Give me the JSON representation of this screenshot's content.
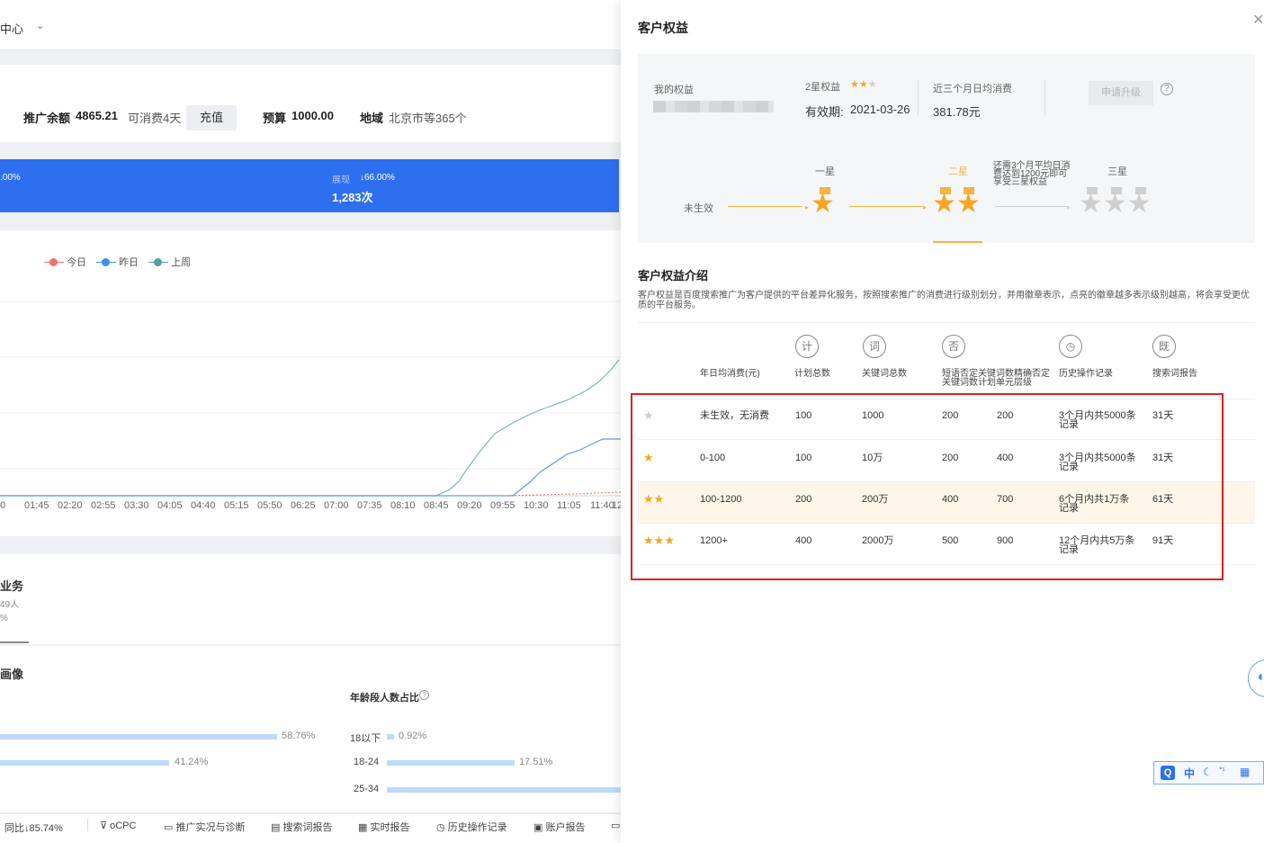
{
  "left": {
    "nav_title": "中心",
    "nav_chevron": "chevron-down-icon",
    "account": {
      "balance_label": "推广余额",
      "balance_value": "4865.21",
      "days_text": "可消费4天",
      "recharge_label": "充值",
      "budget_label": "预算",
      "budget_value": "1000.00",
      "region_label": "地域",
      "region_value": "北京市等365个"
    },
    "metric_bar": {
      "left_value": ".00%",
      "right_label": "展现",
      "right_change": "↓66.00%",
      "right_value": "1,283次"
    },
    "legend": [
      {
        "label": "今日",
        "color": "#f07070"
      },
      {
        "label": "昨日",
        "color": "#3f8ef0"
      },
      {
        "label": "上周",
        "color": "#4fa3a0"
      }
    ],
    "x_ticks": [
      "0",
      "01:45",
      "02:20",
      "02:55",
      "03:30",
      "04:05",
      "04:40",
      "05:15",
      "05:50",
      "06:25",
      "07:00",
      "07:35",
      "08:10",
      "08:45",
      "09:20",
      "09:55",
      "10:30",
      "11:05",
      "11:40",
      "12"
    ],
    "business": {
      "title": "业务",
      "sub1": "49人",
      "sub2": "%"
    },
    "portrait": {
      "title": "画像",
      "age_title": "年龄段人数占比",
      "gender_bars": [
        "58.76%",
        "41.24%"
      ],
      "age_rows": [
        {
          "label": "18以下",
          "value": "0.92%"
        },
        {
          "label": "18-24",
          "value": "17.51%"
        },
        {
          "label": "25-34",
          "value": ""
        }
      ]
    },
    "bottom_bar": {
      "compare": "同比↓85.74%",
      "items": [
        "oCPC",
        "推广实况与诊断",
        "搜索词报告",
        "实时报告",
        "历史操作记录",
        "账户报告"
      ]
    }
  },
  "drawer": {
    "title": "客户权益",
    "close_icon": "close-icon",
    "my": {
      "label": "我的权益",
      "level_label": "2星权益",
      "validity_label": "有效期:",
      "validity_value": "2021-03-26",
      "avg_label": "近三个月日均消费",
      "avg_value": "381.78元",
      "apply_label": "申请升级",
      "help": "?"
    },
    "steps": {
      "inactive": "未生效",
      "one": "一星",
      "two": "二星",
      "three": "三星",
      "hint": "还需3个月平均日消费达到1200元即可享受三星权益"
    },
    "intro_title": "客户权益介绍",
    "intro_text": "客户权益是百度搜索推广为客户提供的平台差异化服务，按照搜索推广的消费进行级别划分，并用徽章表示，点亮的徽章越多表示级别越高，将会享受更优质的平台服务。",
    "columns": [
      {
        "icon": "计",
        "label": "计划总数"
      },
      {
        "icon": "词",
        "label": "关键词总数"
      },
      {
        "icon": "否",
        "label": "短语否定关键词数精确否定关键词数计划单元层级"
      },
      {
        "icon": "◷",
        "label": "历史操作记录"
      },
      {
        "icon": "既",
        "label": "搜索词报告"
      }
    ],
    "first_col_label": "年日均消费(元)",
    "rows": [
      {
        "stars": 0,
        "spend": "未生效，无消费",
        "plans": "100",
        "keywords": "1000",
        "neg1": "200",
        "neg2": "200",
        "history": "3个月内共5000条记录",
        "report": "31天"
      },
      {
        "stars": 1,
        "spend": "0-100",
        "plans": "100",
        "keywords": "10万",
        "neg1": "200",
        "neg2": "400",
        "history": "3个月内共5000条记录",
        "report": "31天"
      },
      {
        "stars": 2,
        "spend": "100-1200",
        "plans": "200",
        "keywords": "200万",
        "neg1": "400",
        "neg2": "700",
        "history": "6个月内共1万条记录",
        "report": "61天"
      },
      {
        "stars": 3,
        "spend": "1200+",
        "plans": "400",
        "keywords": "2000万",
        "neg1": "500",
        "neg2": "900",
        "history": "12个月内共5万条记录",
        "report": "91天"
      }
    ],
    "ime": {
      "label": "中"
    }
  }
}
